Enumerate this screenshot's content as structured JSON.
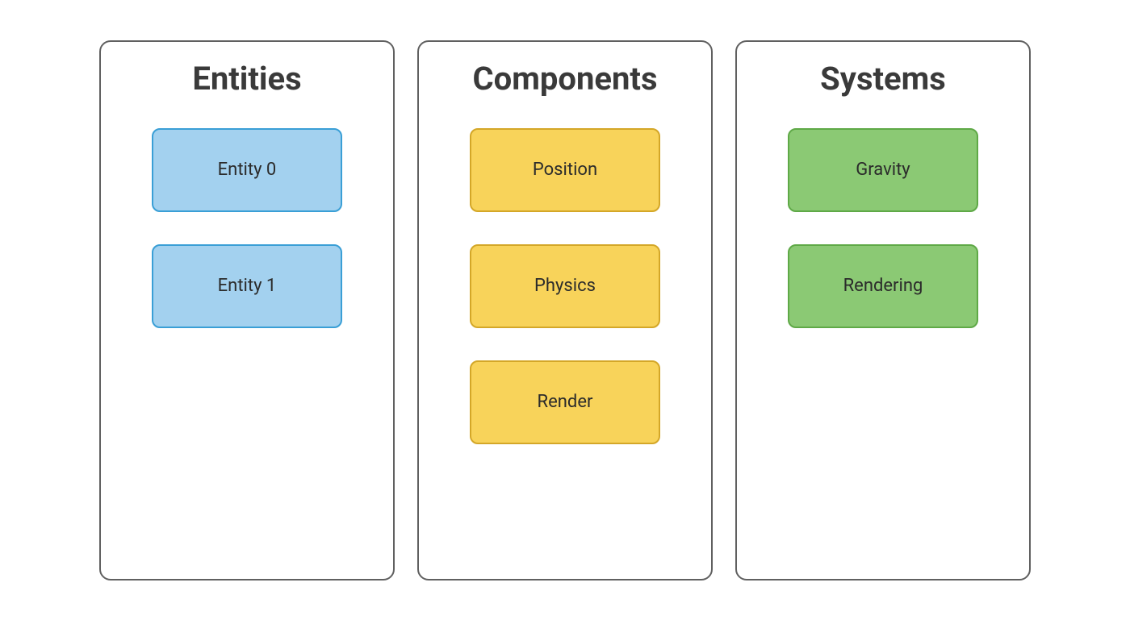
{
  "columns": [
    {
      "title": "Entities",
      "color": "blue",
      "items": [
        "Entity 0",
        "Entity 1"
      ]
    },
    {
      "title": "Components",
      "color": "yellow",
      "items": [
        "Position",
        "Physics",
        "Render"
      ]
    },
    {
      "title": "Systems",
      "color": "green",
      "items": [
        "Gravity",
        "Rendering"
      ]
    }
  ]
}
